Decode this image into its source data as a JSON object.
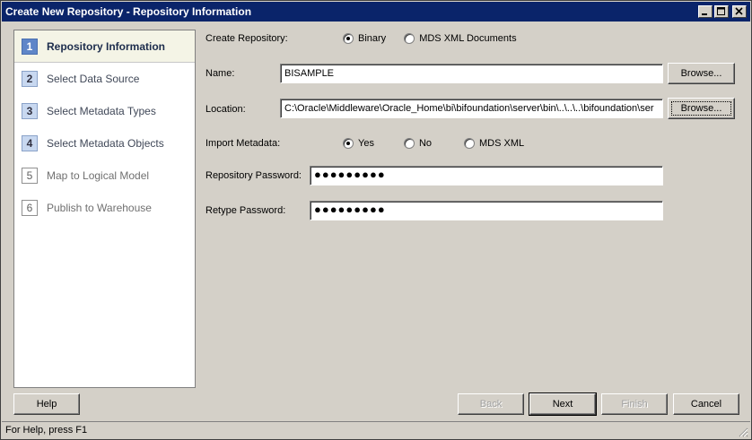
{
  "window": {
    "title": "Create New Repository - Repository Information"
  },
  "steps": [
    {
      "num": "1",
      "label": "Repository Information"
    },
    {
      "num": "2",
      "label": "Select Data Source"
    },
    {
      "num": "3",
      "label": "Select Metadata Types"
    },
    {
      "num": "4",
      "label": "Select Metadata Objects"
    },
    {
      "num": "5",
      "label": "Map to Logical Model"
    },
    {
      "num": "6",
      "label": "Publish to Warehouse"
    }
  ],
  "form": {
    "create_repository_label": "Create Repository:",
    "binary_label": "Binary",
    "mds_xml_documents_label": "MDS XML Documents",
    "name_label": "Name:",
    "name_value": "BISAMPLE",
    "location_label": "Location:",
    "location_value": "C:\\Oracle\\Middleware\\Oracle_Home\\bi\\bifoundation\\server\\bin\\..\\..\\..\\bifoundation\\ser",
    "browse_label": "Browse...",
    "import_metadata_label": "Import Metadata:",
    "yes_label": "Yes",
    "no_label": "No",
    "mds_xml_label": "MDS XML",
    "repository_password_label": "Repository Password:",
    "repository_password_value": "●●●●●●●●●",
    "retype_password_label": "Retype Password:",
    "retype_password_value": "●●●●●●●●●"
  },
  "buttons": {
    "help": "Help",
    "back": "Back",
    "next": "Next",
    "finish": "Finish",
    "cancel": "Cancel"
  },
  "status": {
    "text": "For Help, press F1"
  }
}
